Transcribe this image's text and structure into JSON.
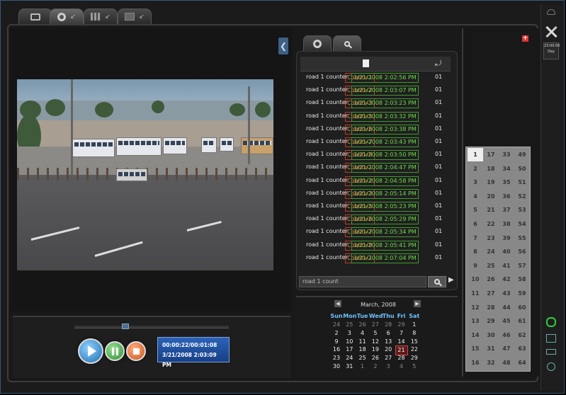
{
  "top_tabs": [
    {
      "icon": "monitor-icon"
    },
    {
      "icon": "settings-ring-icon"
    },
    {
      "icon": "grid-icon"
    },
    {
      "icon": "gray-box-icon"
    }
  ],
  "playback": {
    "progress_time": "00:00:22/00:01:08",
    "timestamp": "3/21/2008 2:03:09 PM",
    "slider_position": 0.33
  },
  "event_list": {
    "rows": [
      {
        "label": "road 1 counter",
        "count": "Count=1",
        "datetime": "3/21/2008 2:02:56 PM",
        "channel": "01"
      },
      {
        "label": "road 1 counter",
        "count": "Count=2",
        "datetime": "3/21/2008 2:03:07 PM",
        "channel": "01"
      },
      {
        "label": "road 1 counter",
        "count": "Count=3",
        "datetime": "3/21/2008 2:03:23 PM",
        "channel": "01"
      },
      {
        "label": "road 1 counter",
        "count": "Count=5",
        "datetime": "3/21/2008 2:03:32 PM",
        "channel": "01"
      },
      {
        "label": "road 1 counter",
        "count": "Count=6",
        "datetime": "3/21/2008 2:03:38 PM",
        "channel": "01"
      },
      {
        "label": "road 1 counter",
        "count": "Count=7",
        "datetime": "3/21/2008 2:03:43 PM",
        "channel": "01"
      },
      {
        "label": "road 1 counter",
        "count": "Count=8",
        "datetime": "3/21/2008 2:03:50 PM",
        "channel": "01"
      },
      {
        "label": "road 1 counter",
        "count": "Count=1",
        "datetime": "3/21/2008 2:04:47 PM",
        "channel": "01"
      },
      {
        "label": "road 1 counter",
        "count": "Count=2",
        "datetime": "3/21/2008 2:04:58 PM",
        "channel": "01"
      },
      {
        "label": "road 1 counter",
        "count": "Count=3",
        "datetime": "3/21/2008 2:05:14 PM",
        "channel": "01"
      },
      {
        "label": "road 1 counter",
        "count": "Count=5",
        "datetime": "3/21/2008 2:05:23 PM",
        "channel": "01"
      },
      {
        "label": "road 1 counter",
        "count": "Count=6",
        "datetime": "3/21/2008 2:05:29 PM",
        "channel": "01"
      },
      {
        "label": "road 1 counter",
        "count": "Count=7",
        "datetime": "3/21/2008 2:05:34 PM",
        "channel": "01"
      },
      {
        "label": "road 1 counter",
        "count": "Count=8",
        "datetime": "3/21/2008 2:05:41 PM",
        "channel": "01"
      },
      {
        "label": "road 1 counter",
        "count": "Count=1",
        "datetime": "3/21/2008 2:07:04 PM",
        "channel": "01"
      }
    ],
    "search_value": "road 1 count"
  },
  "calendar": {
    "title": "March, 2008",
    "days_of_week": [
      "Sun",
      "Mon",
      "Tue",
      "Wed",
      "Thu",
      "Fri",
      "Sat"
    ],
    "weeks": [
      [
        "24",
        "25",
        "26",
        "27",
        "28",
        "29",
        "1"
      ],
      [
        "2",
        "3",
        "4",
        "5",
        "6",
        "7",
        "8"
      ],
      [
        "9",
        "10",
        "11",
        "12",
        "13",
        "14",
        "15"
      ],
      [
        "16",
        "17",
        "18",
        "19",
        "20",
        "21",
        "22"
      ],
      [
        "23",
        "24",
        "25",
        "26",
        "27",
        "28",
        "29"
      ],
      [
        "30",
        "31",
        "1",
        "2",
        "3",
        "4",
        "5"
      ]
    ],
    "selected_day": "21"
  },
  "channels": {
    "columns": [
      [
        "1",
        "2",
        "3",
        "4",
        "5",
        "6",
        "7",
        "8",
        "9",
        "10",
        "11",
        "12",
        "13",
        "14",
        "15",
        "16"
      ],
      [
        "17",
        "18",
        "19",
        "20",
        "21",
        "22",
        "23",
        "24",
        "25",
        "26",
        "27",
        "28",
        "29",
        "30",
        "31",
        "32"
      ],
      [
        "33",
        "34",
        "35",
        "36",
        "37",
        "38",
        "39",
        "40",
        "41",
        "42",
        "43",
        "44",
        "45",
        "46",
        "47",
        "48"
      ],
      [
        "49",
        "50",
        "51",
        "52",
        "53",
        "54",
        "55",
        "56",
        "57",
        "58",
        "59",
        "60",
        "61",
        "62",
        "63",
        "64"
      ]
    ],
    "selected": "1"
  },
  "side_bar": {
    "clock_time": "23:00:00",
    "clock_mode": "Day"
  },
  "colors": {
    "count_text": "#ff7a45",
    "datetime_text": "#6ddc4a",
    "weekday_header": "#6ec1ff",
    "time_box": "#2b63b8"
  }
}
